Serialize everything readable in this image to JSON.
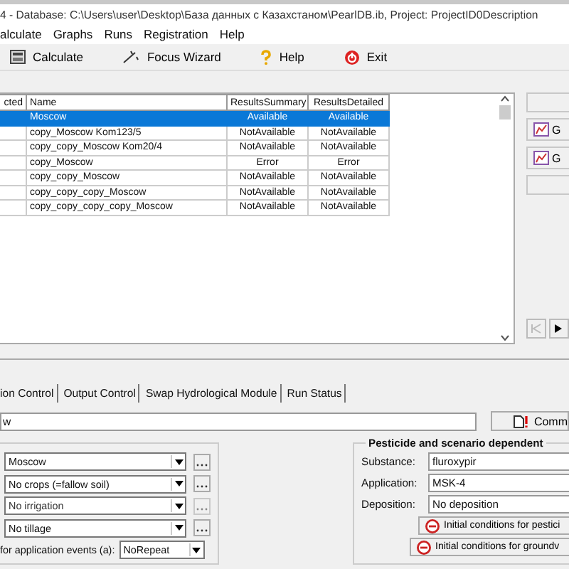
{
  "window": {
    "title": "4 - Database: C:\\Users\\user\\Desktop\\База данных с Казахстаном\\PearlDB.ib, Project: ProjectID0Description"
  },
  "menu": [
    "alculate",
    "Graphs",
    "Runs",
    "Registration",
    "Help"
  ],
  "toolbar": [
    {
      "label": "Calculate"
    },
    {
      "label": "Focus Wizard"
    },
    {
      "label": "Help"
    },
    {
      "label": "Exit"
    }
  ],
  "table": {
    "columns": [
      "cted",
      "Name",
      "ResultsSummary",
      "ResultsDetailed"
    ],
    "rows": [
      {
        "name": "Moscow",
        "summary": "Available",
        "detailed": "Available",
        "selected": true
      },
      {
        "name": "copy_Moscow Kom123/5",
        "summary": "NotAvailable",
        "detailed": "NotAvailable",
        "selected": false
      },
      {
        "name": "copy_copy_Moscow Kom20/4",
        "summary": "NotAvailable",
        "detailed": "NotAvailable",
        "selected": false
      },
      {
        "name": "copy_Moscow",
        "summary": "Error",
        "detailed": "Error",
        "selected": false
      },
      {
        "name": "copy_copy_Moscow",
        "summary": "NotAvailable",
        "detailed": "NotAvailable",
        "selected": false
      },
      {
        "name": "copy_copy_copy_Moscow",
        "summary": "NotAvailable",
        "detailed": "NotAvailable",
        "selected": false
      },
      {
        "name": "copy_copy_copy_copy_Moscow",
        "summary": "NotAvailable",
        "detailed": "NotAvailable",
        "selected": false
      }
    ]
  },
  "side_buttons": [
    "G",
    "G"
  ],
  "tabs": [
    {
      "label": "ion Control",
      "selected": false
    },
    {
      "label": "Output Control",
      "selected": false
    },
    {
      "label": "Swap Hydrological Module",
      "selected": false
    },
    {
      "label": "Run Status",
      "selected": false
    }
  ],
  "description": {
    "value": "w"
  },
  "comment_button": "Comm",
  "scenario": {
    "combos": [
      {
        "value": "Moscow",
        "disabled": false
      },
      {
        "value": "No crops (=fallow soil)",
        "disabled": false
      },
      {
        "value": "No irrigation",
        "disabled": true
      },
      {
        "value": "No tillage",
        "disabled": false
      }
    ],
    "repeat_label": "for application events (a):",
    "repeat_value": "NoRepeat"
  },
  "pesticide": {
    "title": "Pesticide and scenario dependent",
    "fields": [
      {
        "label": "Substance:",
        "value": "fluroxypir"
      },
      {
        "label": "Application:",
        "value": "MSK-4"
      },
      {
        "label": "Deposition:",
        "value": "No deposition"
      }
    ],
    "buttons": [
      "Initial conditions for pestici",
      "Initial conditions for groundv"
    ]
  }
}
